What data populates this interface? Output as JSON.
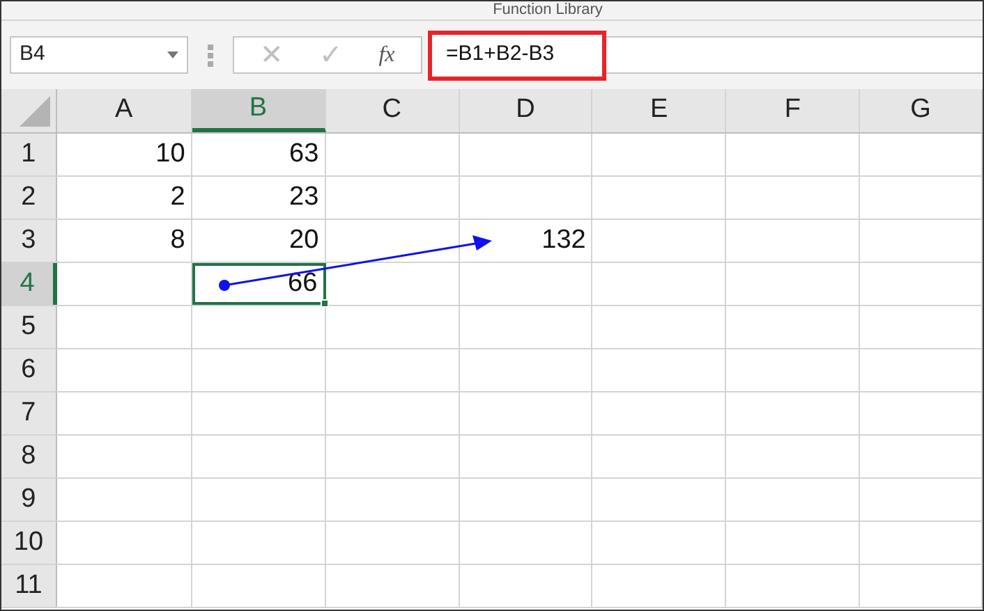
{
  "ribbon_group_label": "Function Library",
  "formula_bar": {
    "name_box": "B4",
    "cancel": "✕",
    "enter": "✓",
    "fx": "fx",
    "formula": "=B1+B2-B3"
  },
  "columns": [
    {
      "label": "A",
      "selected": false
    },
    {
      "label": "B",
      "selected": true
    },
    {
      "label": "C",
      "selected": false
    },
    {
      "label": "D",
      "selected": false
    },
    {
      "label": "E",
      "selected": false
    },
    {
      "label": "F",
      "selected": false
    },
    {
      "label": "G",
      "selected": false
    }
  ],
  "rows": [
    {
      "label": "1",
      "selected": false,
      "cells": [
        {
          "text": "10",
          "selected": false
        },
        {
          "text": "63",
          "selected": false
        },
        null,
        null,
        null,
        null,
        null
      ]
    },
    {
      "label": "2",
      "selected": false,
      "cells": [
        {
          "text": "2",
          "selected": false
        },
        {
          "text": "23",
          "selected": false
        },
        null,
        null,
        null,
        null,
        null
      ]
    },
    {
      "label": "3",
      "selected": false,
      "cells": [
        {
          "text": "8",
          "selected": false
        },
        {
          "text": "20",
          "selected": false
        },
        null,
        {
          "text": "132",
          "selected": false
        },
        null,
        null,
        null
      ]
    },
    {
      "label": "4",
      "selected": true,
      "cells": [
        null,
        {
          "text": "66",
          "selected": true
        },
        null,
        null,
        null,
        null,
        null
      ]
    },
    {
      "label": "5",
      "selected": false,
      "cells": [
        null,
        null,
        null,
        null,
        null,
        null,
        null
      ]
    },
    {
      "label": "6",
      "selected": false,
      "cells": [
        null,
        null,
        null,
        null,
        null,
        null,
        null
      ]
    },
    {
      "label": "7",
      "selected": false,
      "cells": [
        null,
        null,
        null,
        null,
        null,
        null,
        null
      ]
    },
    {
      "label": "8",
      "selected": false,
      "cells": [
        null,
        null,
        null,
        null,
        null,
        null,
        null
      ]
    },
    {
      "label": "9",
      "selected": false,
      "cells": [
        null,
        null,
        null,
        null,
        null,
        null,
        null
      ]
    },
    {
      "label": "10",
      "selected": false,
      "cells": [
        null,
        null,
        null,
        null,
        null,
        null,
        null
      ]
    },
    {
      "label": "11",
      "selected": false,
      "cells": [
        null,
        null,
        null,
        null,
        null,
        null,
        null
      ]
    }
  ]
}
